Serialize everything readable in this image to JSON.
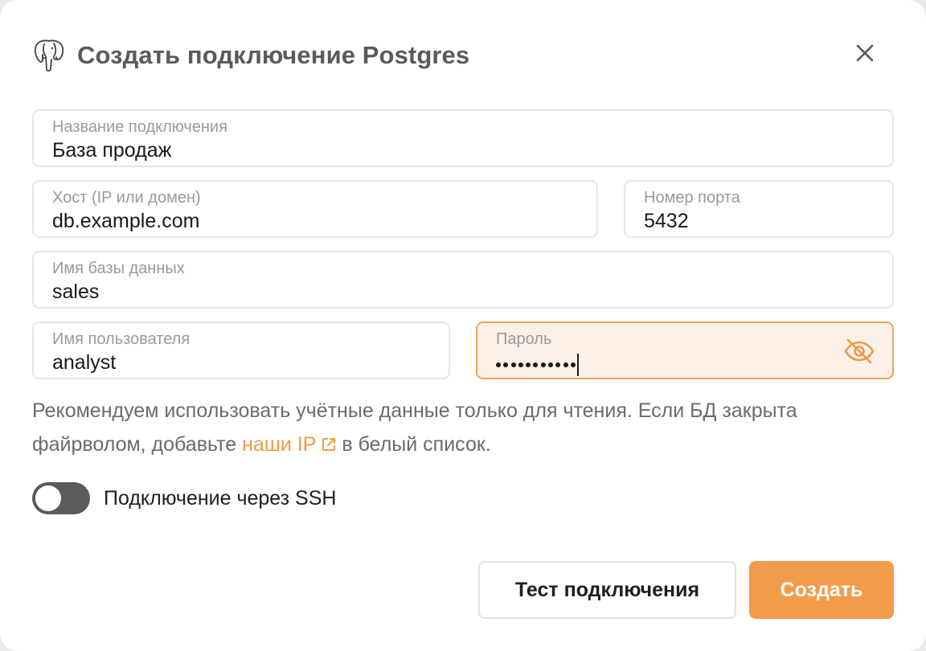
{
  "dialog": {
    "title": "Создать подключение Postgres",
    "logo_icon": "postgres-elephant-icon",
    "close_icon": "close-icon"
  },
  "form": {
    "connection_name": {
      "label": "Название подключения",
      "value": "База продаж"
    },
    "host": {
      "label": "Хост (IP или домен)",
      "value": "db.example.com"
    },
    "port": {
      "label": "Номер порта",
      "value": "5432"
    },
    "database": {
      "label": "Имя базы данных",
      "value": "sales"
    },
    "username": {
      "label": "Имя пользователя",
      "value": "analyst"
    },
    "password": {
      "label": "Пароль",
      "masked_value": "•••••••••••",
      "toggle_icon": "eye-off-icon"
    }
  },
  "hint": {
    "text_before": "Рекомендуем использовать учётные данные только для чтения. Если БД закрыта файрволом, добавьте",
    "link_text": "наши IP",
    "link_icon": "external-link-icon",
    "text_after": "в белый список."
  },
  "ssh": {
    "label": "Подключение через SSH",
    "enabled": false
  },
  "buttons": {
    "test": "Тест подключения",
    "create": "Создать"
  },
  "colors": {
    "accent": "#f29c4b",
    "focused_field_bg": "#fbf1e8",
    "toggle_off": "#5b5b5b"
  }
}
